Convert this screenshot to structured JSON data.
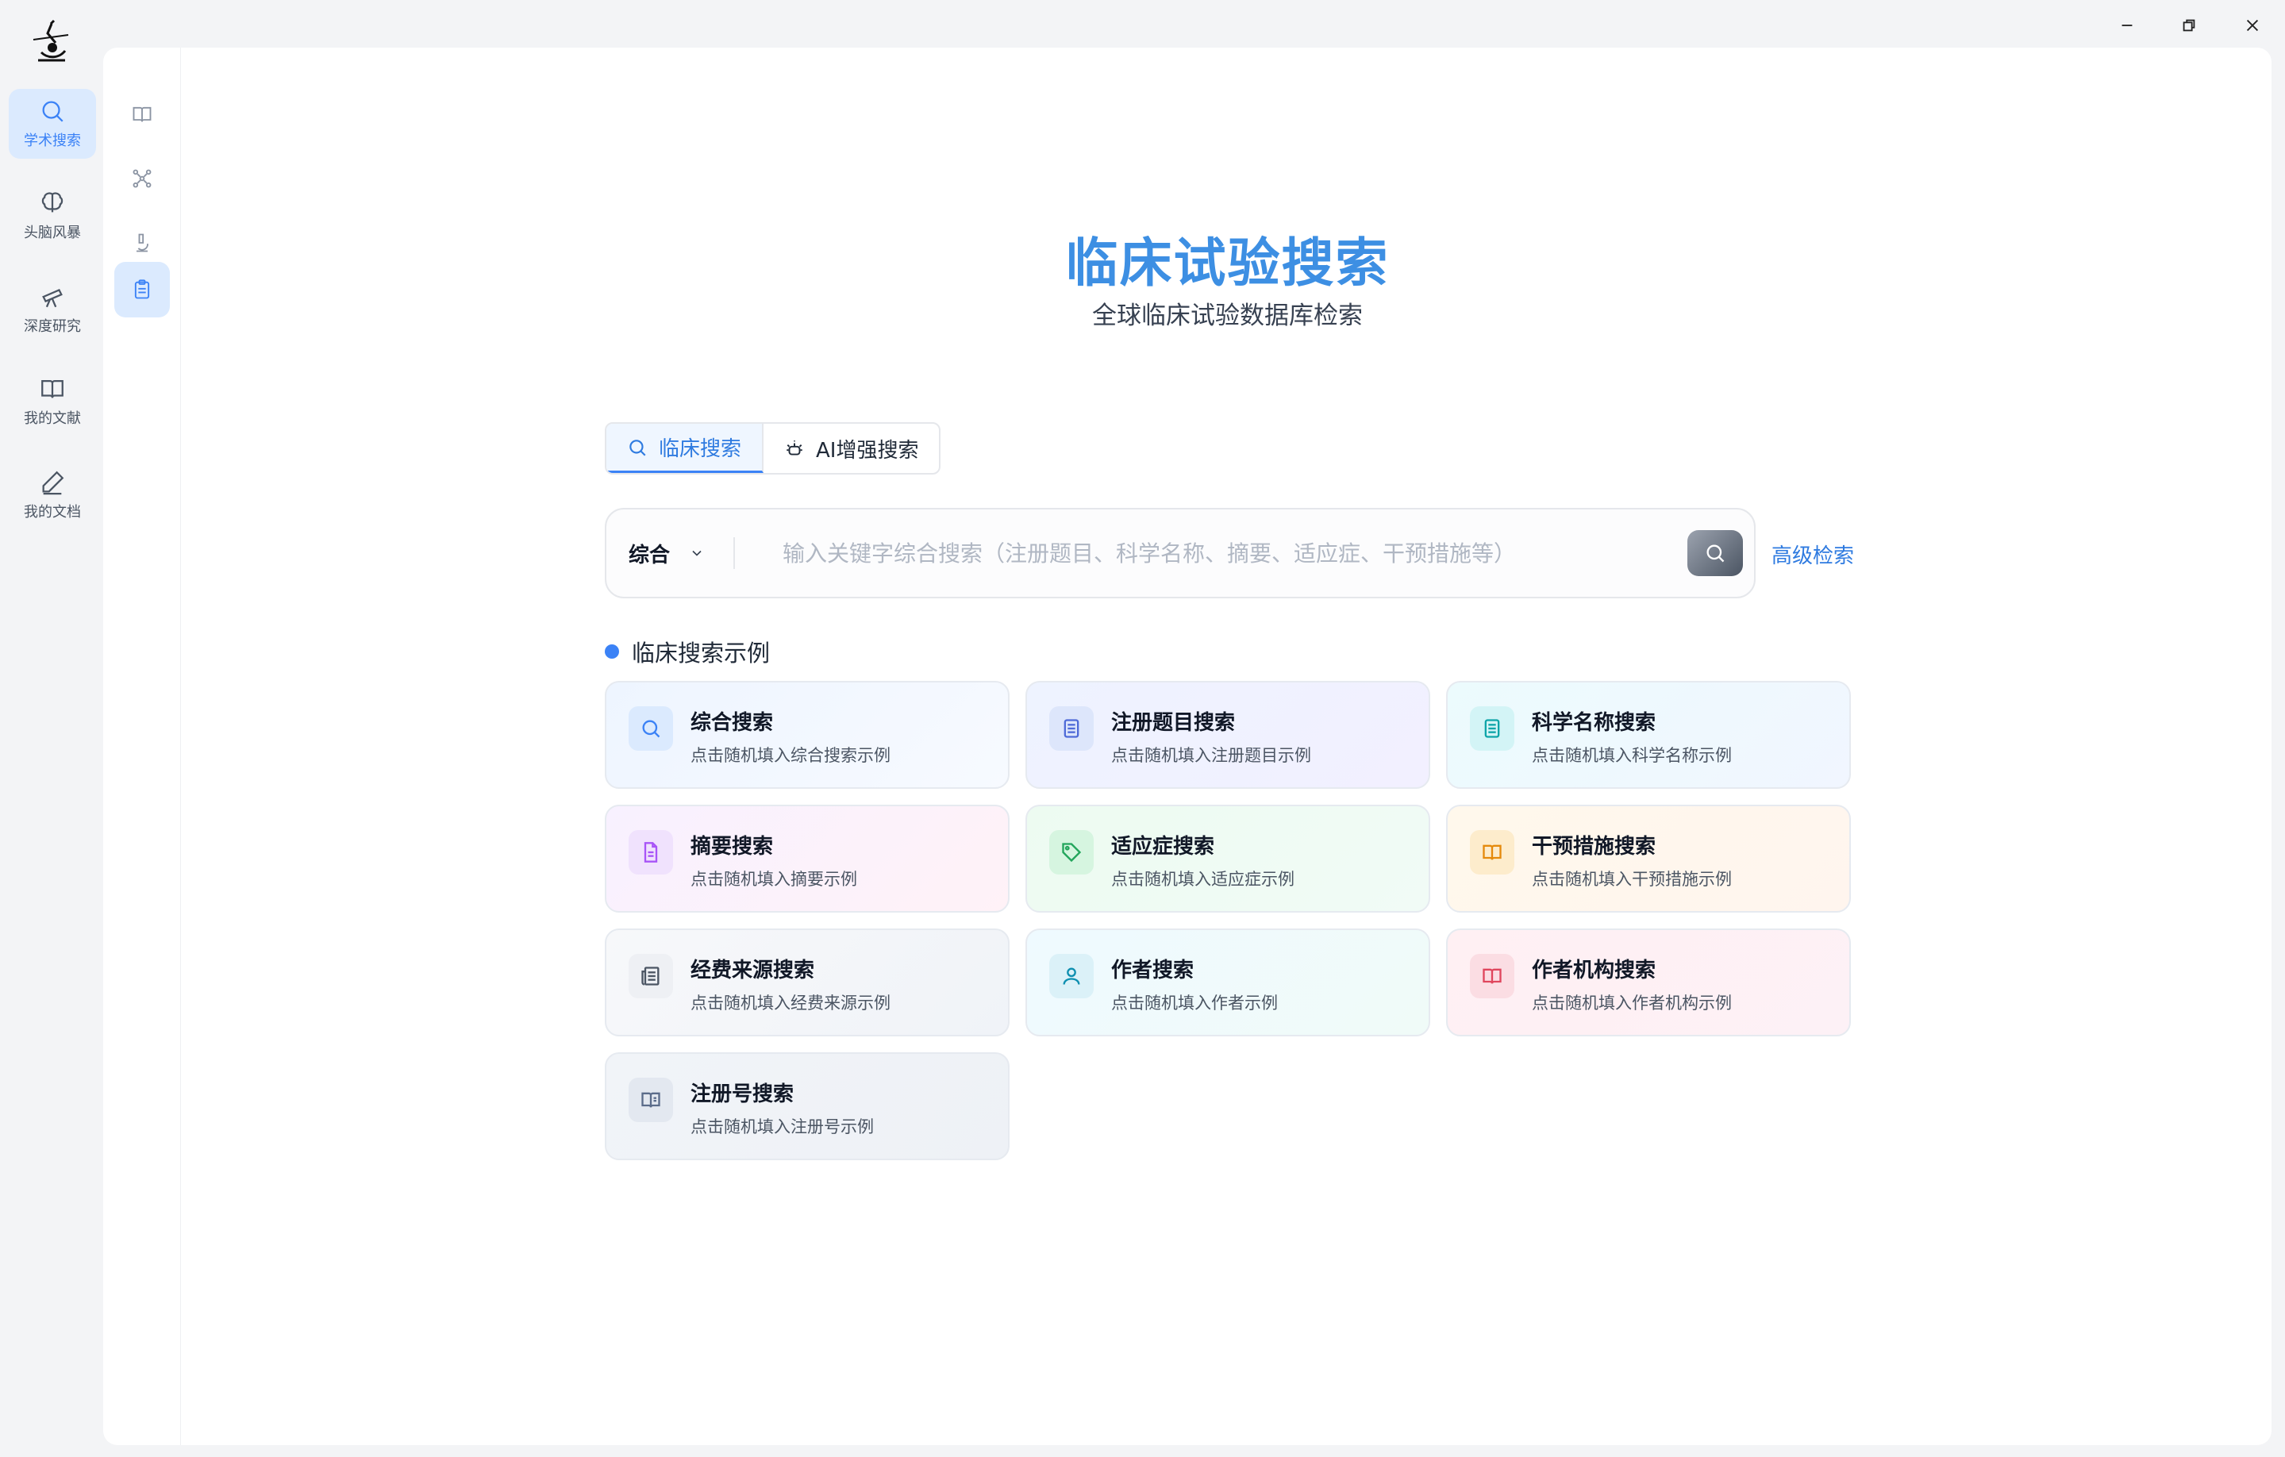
{
  "window_controls": {
    "minimize": "minimize",
    "maximize": "maximize",
    "close": "close"
  },
  "rail": {
    "items": [
      {
        "label": "学术搜索",
        "icon": "search-icon",
        "active": true
      },
      {
        "label": "头脑风暴",
        "icon": "brain-icon",
        "active": false
      },
      {
        "label": "深度研究",
        "icon": "telescope-icon",
        "active": false
      },
      {
        "label": "我的文献",
        "icon": "book-open-icon",
        "active": false
      },
      {
        "label": "我的文档",
        "icon": "pen-icon",
        "active": false
      }
    ]
  },
  "subrail": {
    "items": [
      {
        "icon": "book-icon",
        "active": false
      },
      {
        "icon": "network-icon",
        "active": false
      },
      {
        "icon": "microscope-icon",
        "active": false
      },
      {
        "icon": "clipboard-icon",
        "active": true
      }
    ]
  },
  "header": {
    "title": "临床试验搜索",
    "subtitle": "全球临床试验数据库检索"
  },
  "tabs": [
    {
      "label": "临床搜索",
      "icon": "search-icon",
      "active": true
    },
    {
      "label": "AI增强搜索",
      "icon": "ai-icon",
      "active": false
    }
  ],
  "search": {
    "scope": "综合",
    "placeholder": "输入关键字综合搜索（注册题目、科学名称、摘要、适应症、干预措施等）",
    "value": "",
    "advanced_label": "高级检索"
  },
  "examples": {
    "title": "临床搜索示例",
    "cards": [
      {
        "title": "综合搜索",
        "desc": "点击随机填入综合搜索示例",
        "icon": "search-icon",
        "accent": "#3b82f6"
      },
      {
        "title": "注册题目搜索",
        "desc": "点击随机填入注册题目示例",
        "icon": "document-icon",
        "accent": "#4f6bd8"
      },
      {
        "title": "科学名称搜索",
        "desc": "点击随机填入科学名称示例",
        "icon": "document-icon",
        "accent": "#0ea5a9"
      },
      {
        "title": "摘要搜索",
        "desc": "点击随机填入摘要示例",
        "icon": "file-text-icon",
        "accent": "#a855f7"
      },
      {
        "title": "适应症搜索",
        "desc": "点击随机填入适应症示例",
        "icon": "tag-icon",
        "accent": "#22a55b"
      },
      {
        "title": "干预措施搜索",
        "desc": "点击随机填入干预措施示例",
        "icon": "book-open-icon",
        "accent": "#e58a0c"
      },
      {
        "title": "经费来源搜索",
        "desc": "点击随机填入经费来源示例",
        "icon": "newspaper-icon",
        "accent": "#4b5563"
      },
      {
        "title": "作者搜索",
        "desc": "点击随机填入作者示例",
        "icon": "user-icon",
        "accent": "#0e8fb0"
      },
      {
        "title": "作者机构搜索",
        "desc": "点击随机填入作者机构示例",
        "icon": "book-open-icon",
        "accent": "#e0465d"
      },
      {
        "title": "注册号搜索",
        "desc": "点击随机填入注册号示例",
        "icon": "book-open-icon",
        "accent": "#5b6c8a"
      }
    ]
  }
}
